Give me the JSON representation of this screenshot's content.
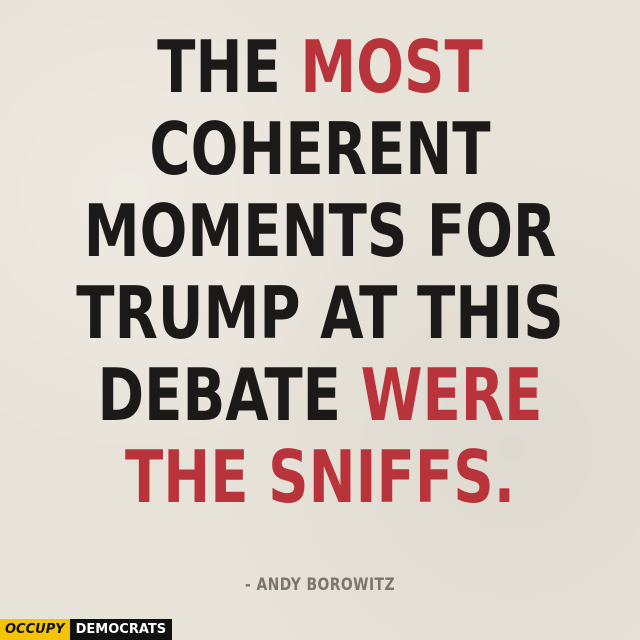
{
  "quote": {
    "line1": {
      "a": "THE ",
      "b": "MOST"
    },
    "line2": "COHERENT",
    "line3": "MOMENTS FOR",
    "line4": "TRUMP AT THIS",
    "line5": {
      "a": "DEBATE ",
      "b": "WERE"
    },
    "line6": "THE SNIFFS."
  },
  "attribution": "- ANDY BOROWITZ",
  "brand": {
    "part1": "OCCUPY",
    "part2": "DEMOCRATS"
  },
  "colors": {
    "background": "#e8e3d9",
    "text": "#1b1a18",
    "accent_red": "#b8343a",
    "attribution": "#7a766f",
    "brand_yellow": "#f5c400",
    "brand_black": "#111111"
  }
}
